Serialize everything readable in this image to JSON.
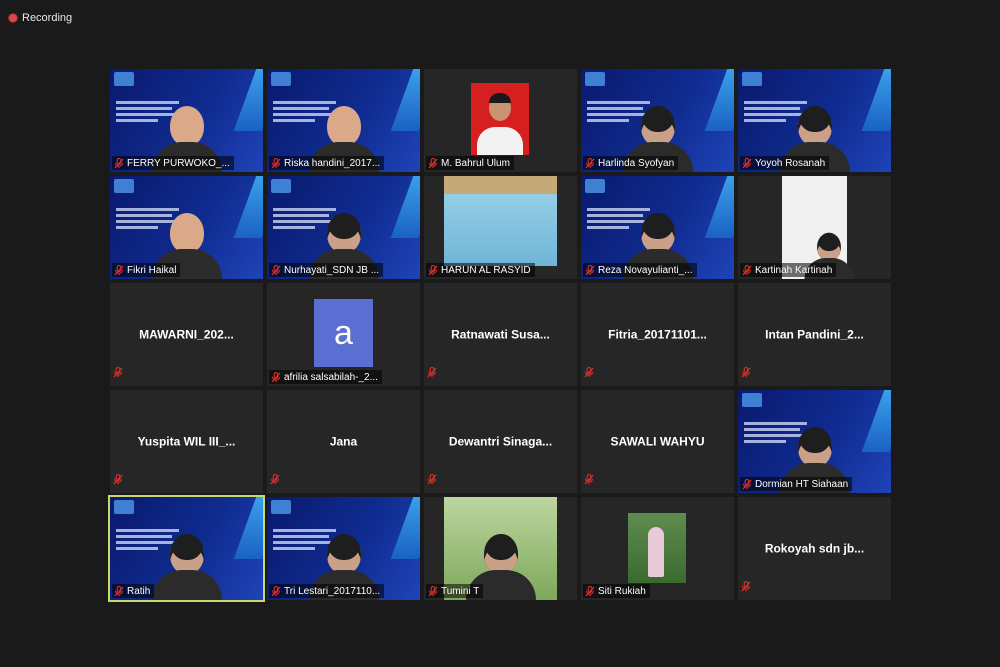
{
  "recording": {
    "label": "Recording"
  },
  "participants": [
    {
      "name": "FERRY PURWOKO_...",
      "video": "banner-person"
    },
    {
      "name": "Riska handini_2017...",
      "video": "banner-person"
    },
    {
      "name": "M. Bahrul Ulum",
      "video": "photo-red"
    },
    {
      "name": "Harlinda Syofyan",
      "video": "banner-hijab"
    },
    {
      "name": "Yoyoh Rosanah",
      "video": "banner-hijab"
    },
    {
      "name": "Fikri Haikal",
      "video": "banner-person"
    },
    {
      "name": "Nurhayati_SDN JB ...",
      "video": "banner-hijab"
    },
    {
      "name": "HARUN AL RASYID",
      "video": "blue-wall"
    },
    {
      "name": "Reza Novayulianti_...",
      "video": "banner-hijab"
    },
    {
      "name": "Kartinah Kartinah",
      "video": "room-white"
    },
    {
      "name": "MAWARNI_202...",
      "video": "none"
    },
    {
      "name": "afrilia salsabilah-_2...",
      "video": "avatar",
      "avatar_letter": "a"
    },
    {
      "name": "Ratnawati  Susa...",
      "video": "none"
    },
    {
      "name": "Fitria_20171101...",
      "video": "none"
    },
    {
      "name": "Intan  Pandini_2...",
      "video": "none"
    },
    {
      "name": "Yuspita WIL III_...",
      "video": "none"
    },
    {
      "name": "Jana",
      "video": "none"
    },
    {
      "name": "Dewantri  Sinaga...",
      "video": "none"
    },
    {
      "name": "SAWALI WAHYU",
      "video": "none"
    },
    {
      "name": "Dormian HT Siahaan",
      "video": "banner-hijab"
    },
    {
      "name": "Ratih",
      "video": "banner-hijab",
      "active": true
    },
    {
      "name": "Tri Lestari_2017110...",
      "video": "banner-hijab"
    },
    {
      "name": "Tumini T",
      "video": "green-room"
    },
    {
      "name": "Siti Rukiah",
      "video": "outdoor"
    },
    {
      "name": "Rokoyah sdn jb...",
      "video": "none"
    }
  ],
  "colors": {
    "background": "#1a1a1a",
    "tile": "#262626",
    "active_border": "#c8d96a",
    "muted_mic": "#e0302b",
    "recording_dot": "#e04545"
  },
  "icons": {
    "mic": "muted-mic-icon",
    "recording": "recording-icon"
  }
}
